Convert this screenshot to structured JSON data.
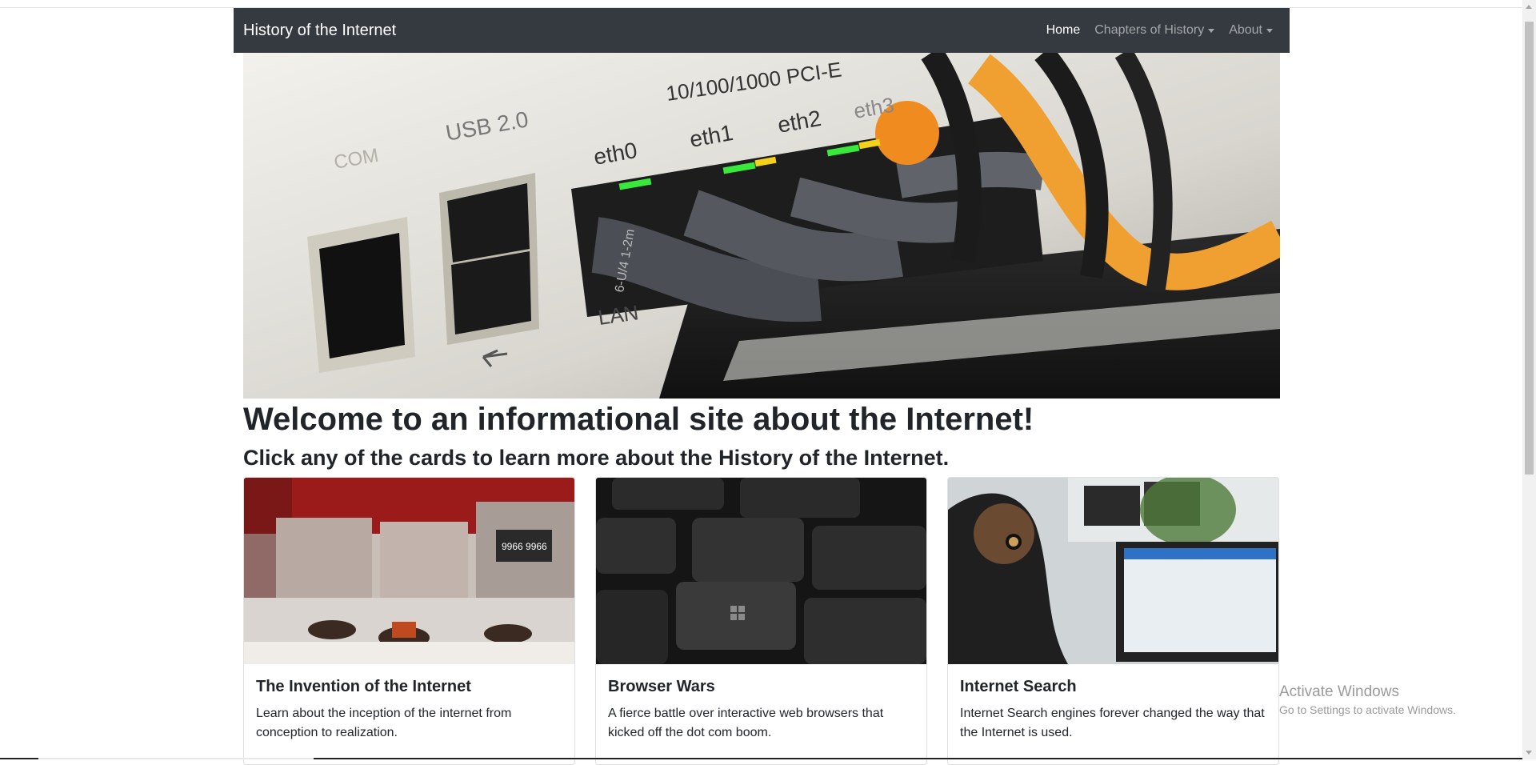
{
  "navbar": {
    "brand": "History of the Internet",
    "items": [
      {
        "label": "Home",
        "active": true,
        "dropdown": false
      },
      {
        "label": "Chapters of History",
        "active": false,
        "dropdown": true
      },
      {
        "label": "About",
        "active": false,
        "dropdown": true
      }
    ]
  },
  "hero": {
    "labels": {
      "pcie": "10/100/1000 PCI-E",
      "usb": "USB 2.0",
      "com": "COM",
      "eth0": "eth0",
      "eth1": "eth1",
      "eth2": "eth2",
      "eth3": "eth3",
      "lan": "LAN",
      "plug": "6-U/4 1-2m"
    }
  },
  "main": {
    "heading": "Welcome to an informational site about the Internet!",
    "subheading": "Click any of the cards to learn more about the History of the Internet.",
    "cards": [
      {
        "title": "The Invention of the Internet",
        "text": "Learn about the inception of the internet from conception to realization.",
        "image_text": "9966 9966"
      },
      {
        "title": "Browser Wars",
        "text": "A fierce battle over interactive web browsers that kicked off the dot com boom."
      },
      {
        "title": "Internet Search",
        "text": "Internet Search engines forever changed the way that the Internet is used."
      }
    ]
  },
  "watermark": {
    "line1": "Activate Windows",
    "line2": "Go to Settings to activate Windows."
  },
  "colors": {
    "navbar_bg": "#343a40",
    "cable_orange": "#f0a030",
    "led_green": "#39e83a"
  }
}
